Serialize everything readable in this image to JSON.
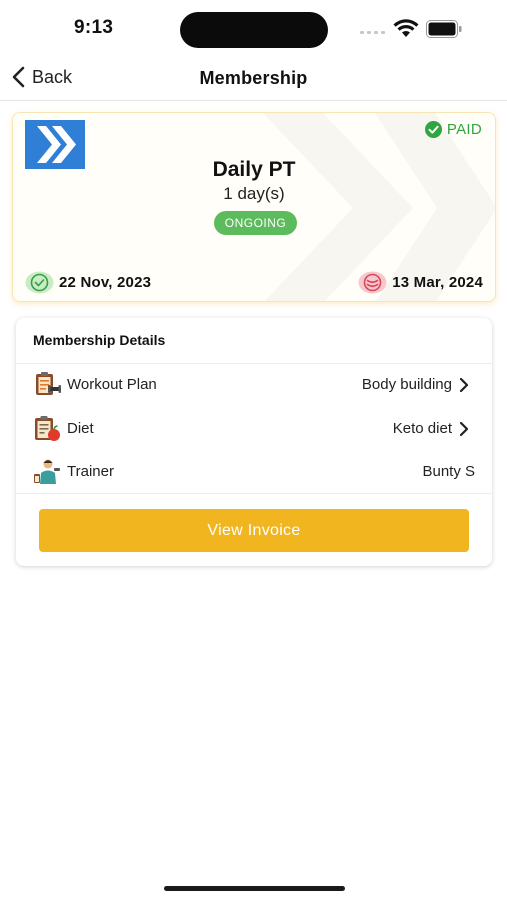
{
  "status_bar": {
    "time": "9:13",
    "icons": [
      "signal-icon",
      "wifi-icon",
      "battery-icon"
    ]
  },
  "nav": {
    "back_label": "Back",
    "title": "Membership",
    "back_icon": "chevron-left-icon"
  },
  "membership": {
    "plan_name": "Daily PT",
    "duration": "1 day(s)",
    "status": "ONGOING",
    "payment_status": "PAID",
    "start_date": "22 Nov, 2023",
    "end_date": "13 Mar, 2024",
    "icons": [
      "brand-logo-icon",
      "check-circle-icon",
      "clock-start-icon",
      "clock-end-icon"
    ]
  },
  "details": {
    "title": "Membership Details",
    "rows": [
      {
        "label": "Workout Plan",
        "value": "Body building",
        "icon": "workout-plan-icon",
        "has_chevron": true
      },
      {
        "label": "Diet",
        "value": "Keto diet",
        "icon": "diet-icon",
        "has_chevron": true
      },
      {
        "label": "Trainer",
        "value": "Bunty S",
        "icon": "trainer-icon",
        "has_chevron": false
      }
    ],
    "button_label": "View Invoice"
  },
  "colors": {
    "accent": "#f0b51f",
    "status_green": "#5cbb5c",
    "paid_green": "#2fa63f",
    "brand_blue": "#2f7fd6",
    "end_date_red": "#e05a6a"
  }
}
